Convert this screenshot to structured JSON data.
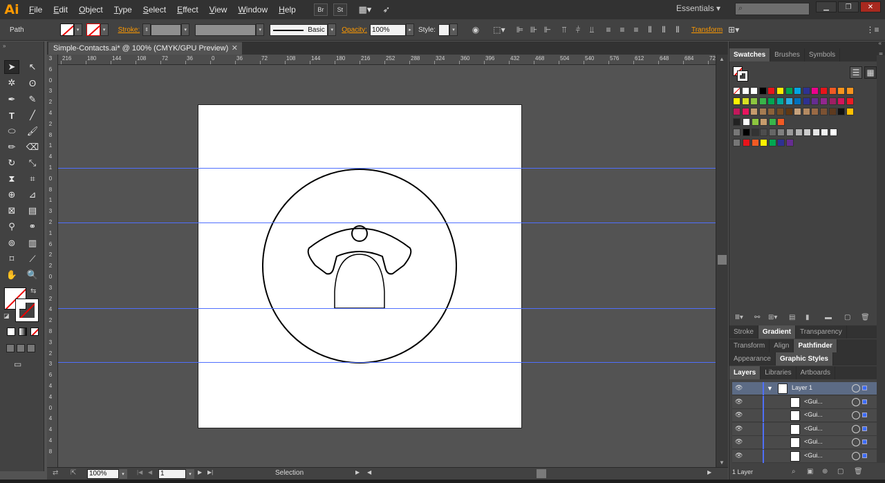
{
  "app": {
    "logo": "Ai",
    "workspace": "Essentials ▾"
  },
  "menu": [
    {
      "label": "File",
      "key": "F",
      "rest": "ile"
    },
    {
      "label": "Edit",
      "key": "E",
      "rest": "dit"
    },
    {
      "label": "Object",
      "key": "O",
      "rest": "bject"
    },
    {
      "label": "Type",
      "key": "T",
      "rest": "ype"
    },
    {
      "label": "Select",
      "key": "S",
      "rest": "elect"
    },
    {
      "label": "Effect",
      "key": "C",
      "rest": "ffect"
    },
    {
      "label": "View",
      "key": "V",
      "rest": "iew"
    },
    {
      "label": "Window",
      "key": "W",
      "rest": "indow"
    },
    {
      "label": "Help",
      "key": "H",
      "rest": "elp"
    }
  ],
  "bridge_buttons": {
    "br": "Br",
    "st": "St"
  },
  "controlbar": {
    "selection_label": "Path",
    "stroke_label": "Stroke:",
    "brush_label": "Basic",
    "opacity_label": "Opacity:",
    "opacity_value": "100%",
    "style_label": "Style:",
    "transform_label": "Transform"
  },
  "document_tab": {
    "title": "Simple-Contacts.ai* @ 100% (CMYK/GPU Preview)",
    "close": "✕"
  },
  "ruler_h": [
    "216",
    "180",
    "144",
    "108",
    "72",
    "36",
    "0",
    "36",
    "72",
    "108",
    "144",
    "180",
    "216",
    "252",
    "288",
    "324",
    "360",
    "396",
    "432",
    "468",
    "504",
    "540",
    "576",
    "612",
    "648",
    "684",
    "720",
    "756"
  ],
  "ruler_v": [
    "3",
    "6",
    "0",
    "3",
    "2",
    "4",
    "2",
    "8",
    "1",
    "4",
    "1",
    "0",
    "8",
    "1",
    "3",
    "2",
    "1",
    "6",
    "2",
    "2",
    "0",
    "3",
    "2",
    "4",
    "2",
    "8",
    "3",
    "2",
    "3",
    "6",
    "4",
    "4",
    "0",
    "4",
    "4",
    "4",
    "8"
  ],
  "statusbar": {
    "zoom": "100%",
    "artboard": "1",
    "tool": "Selection"
  },
  "panels": {
    "swatch_tabs": [
      {
        "label": "Swatches",
        "active": true
      },
      {
        "label": "Brushes"
      },
      {
        "label": "Symbols"
      }
    ],
    "group2_tabs": [
      {
        "label": "Stroke"
      },
      {
        "label": "Gradient",
        "active": true
      },
      {
        "label": "Transparency"
      }
    ],
    "group3_tabs": [
      {
        "label": "Transform"
      },
      {
        "label": "Align"
      },
      {
        "label": "Pathfinder",
        "active": true
      }
    ],
    "group4_tabs": [
      {
        "label": "Appearance"
      },
      {
        "label": "Graphic Styles",
        "active": true
      }
    ],
    "group5_tabs": [
      {
        "label": "Layers",
        "active": true
      },
      {
        "label": "Libraries"
      },
      {
        "label": "Artboards"
      }
    ],
    "layers": [
      {
        "name": "Layer 1",
        "top": true
      },
      {
        "name": "<Gui..."
      },
      {
        "name": "<Gui..."
      },
      {
        "name": "<Gui..."
      },
      {
        "name": "<Gui..."
      },
      {
        "name": "<Gui..."
      }
    ],
    "layers_count": "1 Layer"
  },
  "swatch_rows": [
    [
      "none",
      "#ffffff",
      "#ffffff",
      "#000000",
      "#e8141b",
      "#ffec00",
      "#00a650",
      "#00a6e4",
      "#2e3192",
      "#ec008c",
      "#e8141b",
      "#f15a24",
      "#f7941d",
      "#f7941d"
    ],
    [
      "#fff200",
      "#d7df23",
      "#8dc63f",
      "#39b54a",
      "#00a651",
      "#00a99d",
      "#29abe2",
      "#0071bc",
      "#2e3192",
      "#662d91",
      "#92278f",
      "#9e1f63",
      "#d4145a",
      "#ed1c24"
    ],
    [
      "#c2185b",
      "#e8145e",
      "#c69c6d",
      "#a67c52",
      "#8c6239",
      "#754c24",
      "#603813",
      "#c7a27c",
      "#b48a62",
      "#9a6a45",
      "#7c5233",
      "#5e3a1f",
      "#111111",
      "#ffc000"
    ],
    [
      "#ffffff",
      "#8dc63f",
      "#c69c6d",
      "#39b54a",
      "#f15a24"
    ],
    [
      "#000000",
      "#333333",
      "#4d4d4d",
      "#666666",
      "#808080",
      "#999999",
      "#b3b3b3",
      "#cccccc",
      "#e6e6e6",
      "#f2f2f2",
      "#ffffff"
    ],
    [
      "#e8141b",
      "#f15a24",
      "#fff200",
      "#00a651",
      "#2e3192",
      "#662d91"
    ]
  ],
  "colors": {
    "guide": "#4f6fff",
    "accent": "#ff9a00",
    "selection": "#3b6cf7"
  }
}
